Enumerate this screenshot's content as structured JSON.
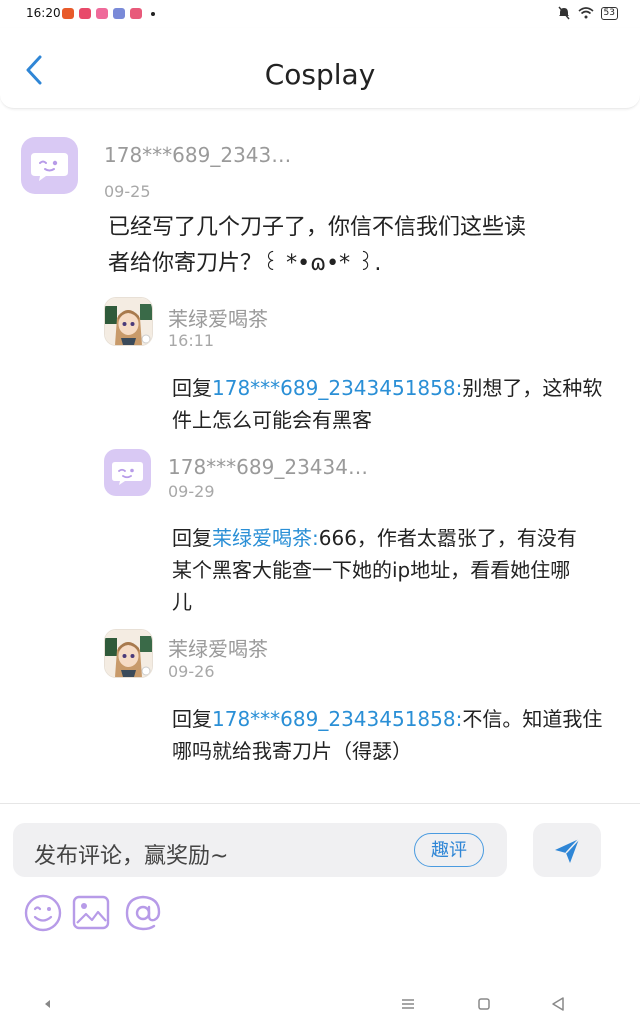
{
  "status_bar": {
    "time": "16:20",
    "battery": "53"
  },
  "header": {
    "title": "Cosplay",
    "back_icon": "chevron-left-icon"
  },
  "comment": {
    "username": "178***689_2343…",
    "date": "09-25",
    "text_line1": "已经写了几个刀子了，你信不信我们这些读",
    "text_line2": "者给你寄刀片？꒰ *•ɷ•* ꒱."
  },
  "replies": [
    {
      "username": "茉绿爱喝茶",
      "time": "16:11",
      "prefix": "回复",
      "mention": "178***689_2343451858:",
      "line1_rest": "别想了，这种软",
      "line2": "件上怎么可能会有黑客",
      "line3": ""
    },
    {
      "username": "178***689_23434…",
      "time": "09-29",
      "prefix": "回复",
      "mention": "茉绿爱喝茶:",
      "line1_rest": "666，作者太嚣张了，有没有",
      "line2": "某个黑客大能查一下她的ip地址，看看她住哪",
      "line3": "儿"
    },
    {
      "username": "茉绿爱喝茶",
      "time": "09-26",
      "prefix": "回复",
      "mention": "178***689_2343451858:",
      "line1_rest": "不信。知道我住",
      "line2": "哪吗就给我寄刀片（得瑟）",
      "line3": ""
    }
  ],
  "composer": {
    "placeholder": "发布评论，赢奖励~",
    "fun_comment_label": "趣评",
    "tools": [
      "emoji-icon",
      "image-icon",
      "at-icon"
    ]
  },
  "colors": {
    "accent": "#2a8fd6",
    "avatar_bg": "#d9c9f4",
    "tool_icon": "#b79be8"
  }
}
